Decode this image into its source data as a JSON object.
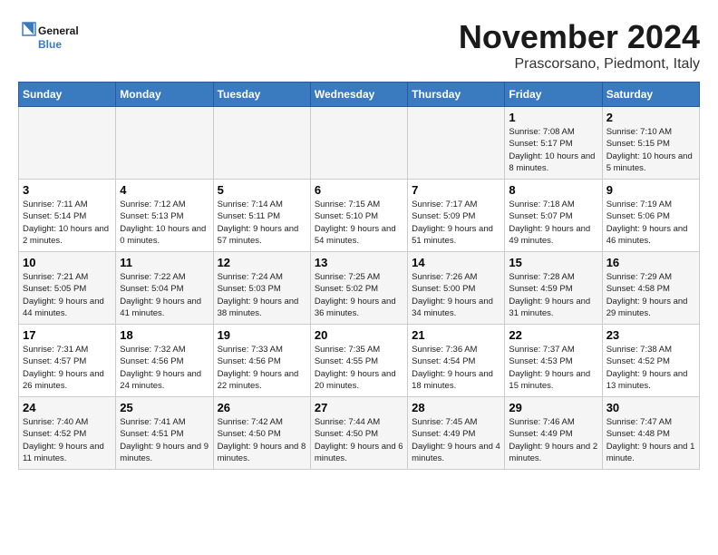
{
  "logo": {
    "line1": "General",
    "line2": "Blue"
  },
  "title": "November 2024",
  "subtitle": "Prascorsano, Piedmont, Italy",
  "days_of_week": [
    "Sunday",
    "Monday",
    "Tuesday",
    "Wednesday",
    "Thursday",
    "Friday",
    "Saturday"
  ],
  "weeks": [
    [
      {
        "day": "",
        "info": ""
      },
      {
        "day": "",
        "info": ""
      },
      {
        "day": "",
        "info": ""
      },
      {
        "day": "",
        "info": ""
      },
      {
        "day": "",
        "info": ""
      },
      {
        "day": "1",
        "info": "Sunrise: 7:08 AM\nSunset: 5:17 PM\nDaylight: 10 hours\nand 8 minutes."
      },
      {
        "day": "2",
        "info": "Sunrise: 7:10 AM\nSunset: 5:15 PM\nDaylight: 10 hours\nand 5 minutes."
      }
    ],
    [
      {
        "day": "3",
        "info": "Sunrise: 7:11 AM\nSunset: 5:14 PM\nDaylight: 10 hours\nand 2 minutes."
      },
      {
        "day": "4",
        "info": "Sunrise: 7:12 AM\nSunset: 5:13 PM\nDaylight: 10 hours\nand 0 minutes."
      },
      {
        "day": "5",
        "info": "Sunrise: 7:14 AM\nSunset: 5:11 PM\nDaylight: 9 hours\nand 57 minutes."
      },
      {
        "day": "6",
        "info": "Sunrise: 7:15 AM\nSunset: 5:10 PM\nDaylight: 9 hours\nand 54 minutes."
      },
      {
        "day": "7",
        "info": "Sunrise: 7:17 AM\nSunset: 5:09 PM\nDaylight: 9 hours\nand 51 minutes."
      },
      {
        "day": "8",
        "info": "Sunrise: 7:18 AM\nSunset: 5:07 PM\nDaylight: 9 hours\nand 49 minutes."
      },
      {
        "day": "9",
        "info": "Sunrise: 7:19 AM\nSunset: 5:06 PM\nDaylight: 9 hours\nand 46 minutes."
      }
    ],
    [
      {
        "day": "10",
        "info": "Sunrise: 7:21 AM\nSunset: 5:05 PM\nDaylight: 9 hours\nand 44 minutes."
      },
      {
        "day": "11",
        "info": "Sunrise: 7:22 AM\nSunset: 5:04 PM\nDaylight: 9 hours\nand 41 minutes."
      },
      {
        "day": "12",
        "info": "Sunrise: 7:24 AM\nSunset: 5:03 PM\nDaylight: 9 hours\nand 38 minutes."
      },
      {
        "day": "13",
        "info": "Sunrise: 7:25 AM\nSunset: 5:02 PM\nDaylight: 9 hours\nand 36 minutes."
      },
      {
        "day": "14",
        "info": "Sunrise: 7:26 AM\nSunset: 5:00 PM\nDaylight: 9 hours\nand 34 minutes."
      },
      {
        "day": "15",
        "info": "Sunrise: 7:28 AM\nSunset: 4:59 PM\nDaylight: 9 hours\nand 31 minutes."
      },
      {
        "day": "16",
        "info": "Sunrise: 7:29 AM\nSunset: 4:58 PM\nDaylight: 9 hours\nand 29 minutes."
      }
    ],
    [
      {
        "day": "17",
        "info": "Sunrise: 7:31 AM\nSunset: 4:57 PM\nDaylight: 9 hours\nand 26 minutes."
      },
      {
        "day": "18",
        "info": "Sunrise: 7:32 AM\nSunset: 4:56 PM\nDaylight: 9 hours\nand 24 minutes."
      },
      {
        "day": "19",
        "info": "Sunrise: 7:33 AM\nSunset: 4:56 PM\nDaylight: 9 hours\nand 22 minutes."
      },
      {
        "day": "20",
        "info": "Sunrise: 7:35 AM\nSunset: 4:55 PM\nDaylight: 9 hours\nand 20 minutes."
      },
      {
        "day": "21",
        "info": "Sunrise: 7:36 AM\nSunset: 4:54 PM\nDaylight: 9 hours\nand 18 minutes."
      },
      {
        "day": "22",
        "info": "Sunrise: 7:37 AM\nSunset: 4:53 PM\nDaylight: 9 hours\nand 15 minutes."
      },
      {
        "day": "23",
        "info": "Sunrise: 7:38 AM\nSunset: 4:52 PM\nDaylight: 9 hours\nand 13 minutes."
      }
    ],
    [
      {
        "day": "24",
        "info": "Sunrise: 7:40 AM\nSunset: 4:52 PM\nDaylight: 9 hours\nand 11 minutes."
      },
      {
        "day": "25",
        "info": "Sunrise: 7:41 AM\nSunset: 4:51 PM\nDaylight: 9 hours\nand 9 minutes."
      },
      {
        "day": "26",
        "info": "Sunrise: 7:42 AM\nSunset: 4:50 PM\nDaylight: 9 hours\nand 8 minutes."
      },
      {
        "day": "27",
        "info": "Sunrise: 7:44 AM\nSunset: 4:50 PM\nDaylight: 9 hours\nand 6 minutes."
      },
      {
        "day": "28",
        "info": "Sunrise: 7:45 AM\nSunset: 4:49 PM\nDaylight: 9 hours\nand 4 minutes."
      },
      {
        "day": "29",
        "info": "Sunrise: 7:46 AM\nSunset: 4:49 PM\nDaylight: 9 hours\nand 2 minutes."
      },
      {
        "day": "30",
        "info": "Sunrise: 7:47 AM\nSunset: 4:48 PM\nDaylight: 9 hours\nand 1 minute."
      }
    ]
  ]
}
